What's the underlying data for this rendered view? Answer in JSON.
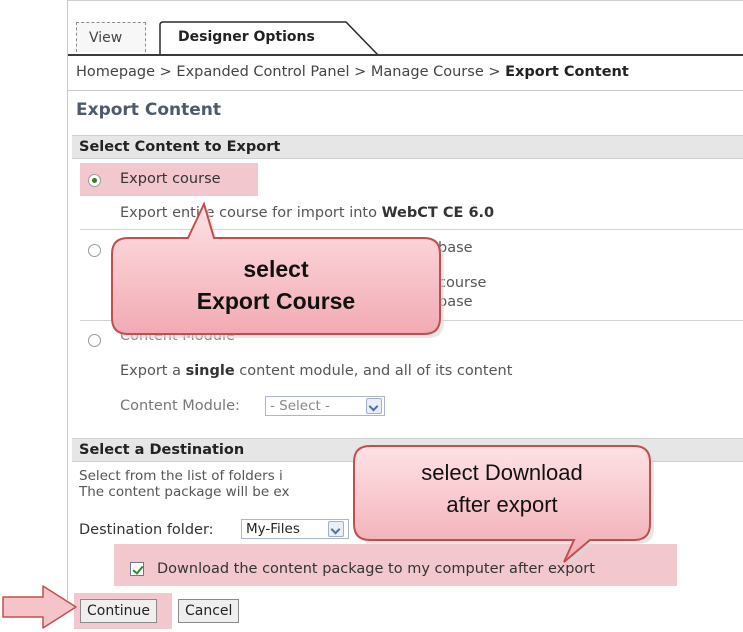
{
  "tabs": {
    "view": "View",
    "designer_options": "Designer Options"
  },
  "breadcrumb": {
    "homepage": "Homepage",
    "separator": ">",
    "expanded_control_panel": "Expanded Control Panel",
    "manage_course": "Manage Course",
    "current": "Export Content"
  },
  "page_title": "Export Content",
  "select_content": {
    "header": "Select Content to Export",
    "export_course": {
      "label": "Export course",
      "selected": true,
      "desc_prefix": "Export enti",
      "desc_mid": "re course for import into ",
      "desc_bold": "WebCT CE 6.0"
    },
    "option2": {
      "line1_fragment": "base",
      "line2_fragment": "course",
      "line3_fragment": "base"
    },
    "content_module": {
      "label": "Content Module",
      "desc_prefix": "Export a ",
      "desc_bold": "single",
      "desc_suffix": " content module, and all of its content",
      "select_label": "Content Module:",
      "select_value": "- Select -"
    }
  },
  "destination": {
    "header": "Select a Destination",
    "desc_line1": "Select from the list of folders i",
    "desc_line2": "The content package will be ex",
    "folder_label": "Destination folder:",
    "folder_value": "My-Files",
    "download_label": "Download the content package to my computer after export",
    "download_checked": true
  },
  "buttons": {
    "continue": "Continue",
    "cancel": "Cancel"
  },
  "callouts": {
    "export_course_line1": "select",
    "export_course_line2": "Export Course",
    "download_line1": "select Download",
    "download_line2": "after export"
  },
  "colors": {
    "highlight": "#f2c8ce",
    "callout_fill": "#f6c3c9",
    "callout_border": "#c0504d"
  }
}
